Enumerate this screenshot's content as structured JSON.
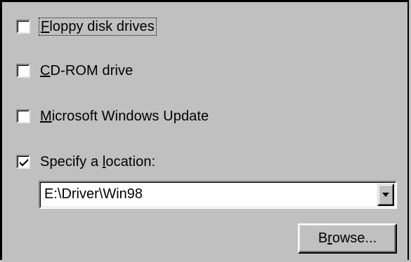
{
  "options": {
    "floppy": {
      "label_ul": "F",
      "label_rest": "loppy disk drives",
      "checked": false
    },
    "cdrom": {
      "label_ul": "C",
      "label_rest": "D-ROM drive",
      "checked": false
    },
    "windows_update": {
      "label_ul": "M",
      "label_rest": "icrosoft Windows Update",
      "checked": false
    },
    "location": {
      "label_pre": "Specify a ",
      "label_ul": "l",
      "label_post": "ocation:",
      "checked": true
    }
  },
  "location_combo": {
    "value": "E:\\Driver\\Win98"
  },
  "browse_button": {
    "label_pre": "B",
    "label_ul": "r",
    "label_post": "owse..."
  }
}
